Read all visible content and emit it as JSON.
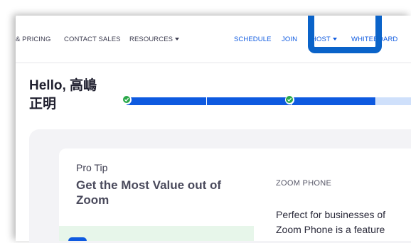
{
  "nav": {
    "items": [
      {
        "label": "& PRICING"
      },
      {
        "label": "CONTACT SALES"
      },
      {
        "label": "RESOURCES"
      }
    ],
    "right_items": [
      {
        "label": "SCHEDULE"
      },
      {
        "label": "JOIN"
      },
      {
        "label": "HOST"
      },
      {
        "label": "WHITEBOARD"
      }
    ]
  },
  "greeting": {
    "line1": "Hello, 高嶋",
    "line2": "正明"
  },
  "progress": {
    "completed_steps": 2,
    "colors": {
      "done": "#0e5ae0",
      "pending": "#cfe0fb",
      "check": "#2ba84a"
    }
  },
  "pro_tip": {
    "label": "Pro Tip",
    "title": "Get the Most Value out of Zoom"
  },
  "zoom_phone": {
    "heading": "ZOOM PHONE",
    "line1": "Perfect for businesses of",
    "line2": "Zoom Phone is a feature"
  },
  "colors": {
    "accent": "#0e5ae0",
    "highlight_box": "#0a63c9"
  }
}
